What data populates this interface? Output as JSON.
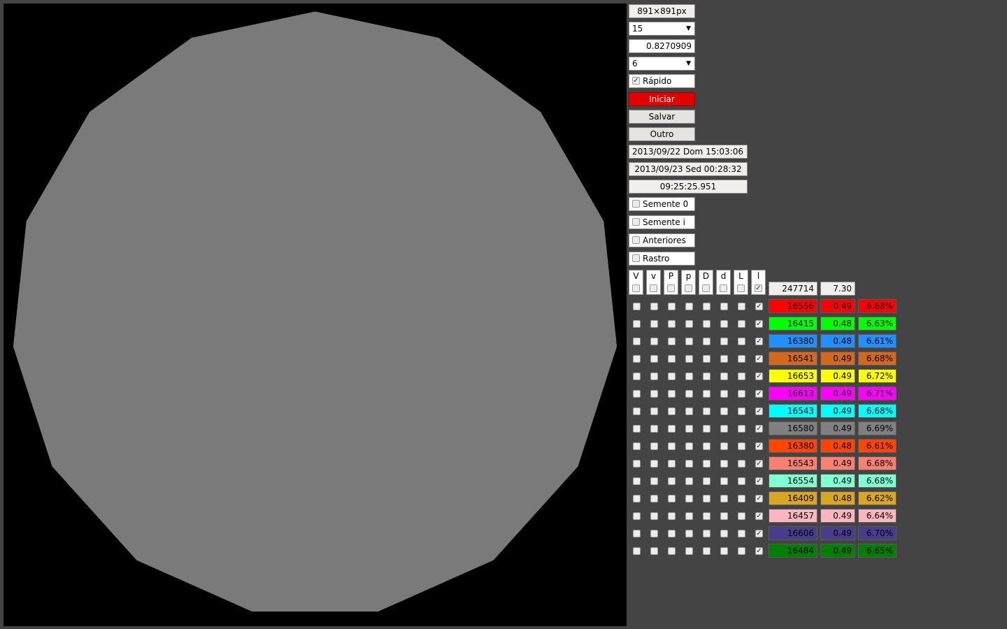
{
  "canvas": {
    "shape": "pentadecagon",
    "fill_color": "#7a7a7a",
    "background": "#000000"
  },
  "controls": {
    "size_label": "891×891px",
    "sides_select": "15",
    "factor_value": "0.8270909",
    "depth_select": "6",
    "rapido_label": "Rápido",
    "rapido_checked": true,
    "start_button": "Iniciar",
    "save_button": "Salvar",
    "other_button": "Outro",
    "start_time": "2013/09/22 Dom 15:03:06",
    "end_time": "2013/09/23 Sed 00:28:32",
    "elapsed": "09:25:25.951",
    "semente0_label": "Semente 0",
    "sementei_label": "Semente i",
    "anteriores_label": "Anteriores",
    "rastro_label": "Rastro"
  },
  "table": {
    "column_headers": [
      "V",
      "v",
      "P",
      "p",
      "D",
      "d",
      "L",
      "l"
    ],
    "header_checked": [
      false,
      false,
      false,
      false,
      false,
      false,
      false,
      true
    ],
    "total_count": "247714",
    "total_value": "7.30",
    "rows": [
      {
        "count": "16556",
        "value": "0.49",
        "percent": "6.68%",
        "color": "#ff0000",
        "text": "#000000"
      },
      {
        "count": "16415",
        "value": "0.48",
        "percent": "6.63%",
        "color": "#00ff00",
        "text": "#000000"
      },
      {
        "count": "16380",
        "value": "0.48",
        "percent": "6.61%",
        "color": "#1e90ff",
        "text": "#000000"
      },
      {
        "count": "16541",
        "value": "0.49",
        "percent": "6.68%",
        "color": "#d2691e",
        "text": "#000000"
      },
      {
        "count": "16653",
        "value": "0.49",
        "percent": "6.72%",
        "color": "#ffff00",
        "text": "#000000"
      },
      {
        "count": "16613",
        "value": "0.49",
        "percent": "6.71%",
        "color": "#ff00ff",
        "text": "#000000"
      },
      {
        "count": "16543",
        "value": "0.49",
        "percent": "6.68%",
        "color": "#00ffff",
        "text": "#000000"
      },
      {
        "count": "16580",
        "value": "0.49",
        "percent": "6.69%",
        "color": "#808080",
        "text": "#000000"
      },
      {
        "count": "16380",
        "value": "0.48",
        "percent": "6.61%",
        "color": "#ff4500",
        "text": "#000000"
      },
      {
        "count": "16543",
        "value": "0.49",
        "percent": "6.68%",
        "color": "#fa8072",
        "text": "#000000"
      },
      {
        "count": "16554",
        "value": "0.49",
        "percent": "6.68%",
        "color": "#7fffd4",
        "text": "#000000"
      },
      {
        "count": "16409",
        "value": "0.48",
        "percent": "6.62%",
        "color": "#daa520",
        "text": "#000000"
      },
      {
        "count": "16457",
        "value": "0.49",
        "percent": "6.64%",
        "color": "#ffb6c1",
        "text": "#000000"
      },
      {
        "count": "16606",
        "value": "0.49",
        "percent": "6.70%",
        "color": "#483d8b",
        "text": "#000000"
      },
      {
        "count": "16484",
        "value": "0.49",
        "percent": "6.65%",
        "color": "#008000",
        "text": "#000000"
      }
    ]
  }
}
